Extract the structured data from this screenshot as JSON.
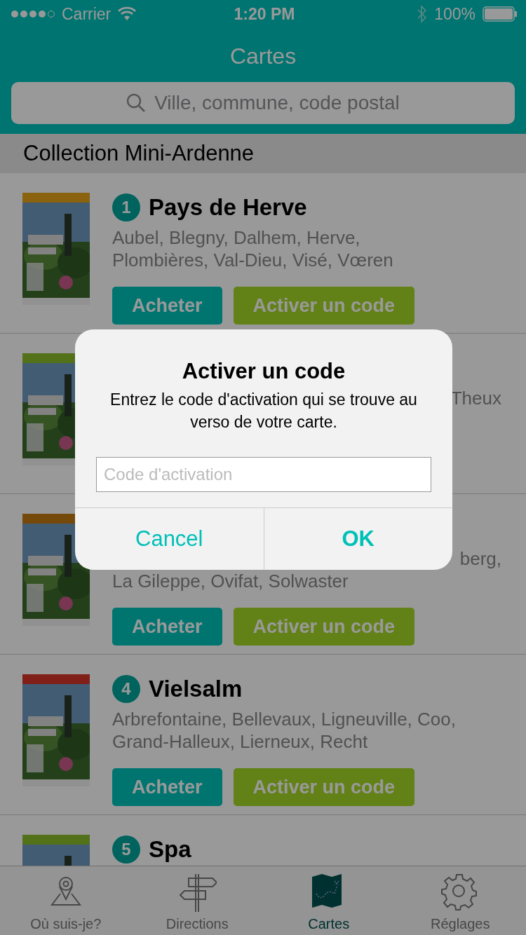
{
  "status_bar": {
    "carrier": "Carrier",
    "time": "1:20 PM",
    "battery": "100%"
  },
  "nav": {
    "title": "Cartes"
  },
  "search": {
    "placeholder": "Ville, commune, code postal"
  },
  "section": {
    "title": "Collection Mini-Ardenne"
  },
  "items": [
    {
      "number": "1",
      "title": "Pays de Herve",
      "lines": [
        {
          "text": "Aubel, Blegny, Dalhem, Herve,",
          "clipped": false
        },
        {
          "text": "Plombières, Val-Dieu, Visé, Vœren",
          "clipped": false
        }
      ],
      "buttons": [
        "Acheter",
        "Activer un code"
      ]
    },
    {
      "lines": [
        {
          "text": "Theux",
          "clipped": true
        }
      ]
    },
    {
      "lines": [
        {
          "text": "berg,",
          "clipped": true
        },
        {
          "text": "La Gileppe, Ovifat, Solwaster",
          "clipped": false
        }
      ],
      "buttons": [
        "Acheter",
        "Activer un code"
      ]
    },
    {
      "number": "4",
      "title": "Vielsalm",
      "lines": [
        {
          "text": "Arbrefontaine, Bellevaux, Ligneuville, Coo,",
          "clipped": false
        },
        {
          "text": "Grand-Halleux, Lierneux, Recht",
          "clipped": false
        }
      ],
      "buttons": [
        "Acheter",
        "Activer un code"
      ]
    },
    {
      "number": "5",
      "title": "Spa"
    }
  ],
  "tabs": [
    {
      "label": "Où suis-je?",
      "selected": false
    },
    {
      "label": "Directions",
      "selected": false
    },
    {
      "label": "Cartes",
      "selected": true
    },
    {
      "label": "Réglages",
      "selected": false
    }
  ],
  "dialog": {
    "title": "Activer un code",
    "message": "Entrez le code d'activation qui se trouve au verso de votre carte.",
    "placeholder": "Code d'activation",
    "buttons": [
      {
        "label": "Cancel",
        "kind": "cancel"
      },
      {
        "label": "OK",
        "kind": "default"
      }
    ]
  }
}
